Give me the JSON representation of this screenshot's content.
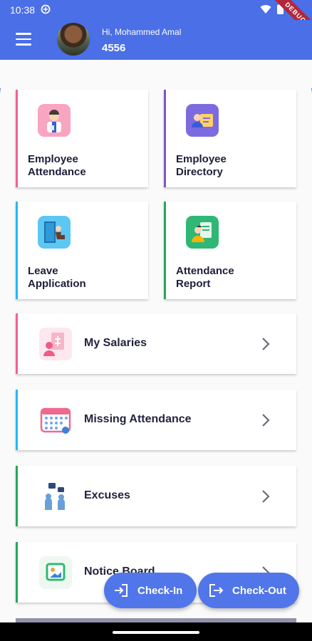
{
  "status_bar": {
    "time": "10:38",
    "debug": "DEBUG"
  },
  "header": {
    "greeting": "Hi, Mohammed Amal",
    "employee_id": "4556"
  },
  "tiles": [
    {
      "label": "Employee\nAttendance",
      "accent": "#f06292",
      "icon": "employee-attendance-icon"
    },
    {
      "label": "Employee\nDirectory",
      "accent": "#7e57c2",
      "icon": "employee-directory-icon"
    },
    {
      "label": "Leave\nApplication",
      "accent": "#29b6f6",
      "icon": "leave-application-icon"
    },
    {
      "label": "Attendance\nReport",
      "accent": "#26a65b",
      "icon": "attendance-report-icon"
    }
  ],
  "rows": [
    {
      "label": "My Salaries",
      "accent": "#f06292",
      "icon": "salary-icon"
    },
    {
      "label": "Missing Attendance",
      "accent": "#29b6f6",
      "icon": "calendar-icon"
    },
    {
      "label": "Excuses",
      "accent": "#26a65b",
      "icon": "excuses-icon"
    },
    {
      "label": "Notice Board",
      "accent": "#26a65b",
      "icon": "notice-board-icon"
    }
  ],
  "actions": {
    "check_in": "Check-In",
    "check_out": "Check-Out"
  }
}
